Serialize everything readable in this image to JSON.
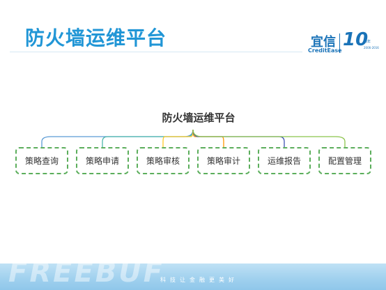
{
  "slide": {
    "title": "防火墙运维平台"
  },
  "logo": {
    "cn": "宜信",
    "en": "CreditEase",
    "ten": "10",
    "ten_sub": "周年",
    "years": "2006-2016"
  },
  "diagram": {
    "title": "防火墙运维平台",
    "nodes": [
      {
        "label": "策略查询",
        "color": "#5b9bd5"
      },
      {
        "label": "策略申请",
        "color": "#4db6ac"
      },
      {
        "label": "策略审核",
        "color": "#ffca28"
      },
      {
        "label": "策略审计",
        "color": "#ff9800"
      },
      {
        "label": "运维报告",
        "color": "#3f51b5"
      },
      {
        "label": "配置管理",
        "color": "#8bc34a"
      }
    ]
  },
  "footer": {
    "watermark": "FREEBUF",
    "slogan": "科技让金融更美好"
  }
}
